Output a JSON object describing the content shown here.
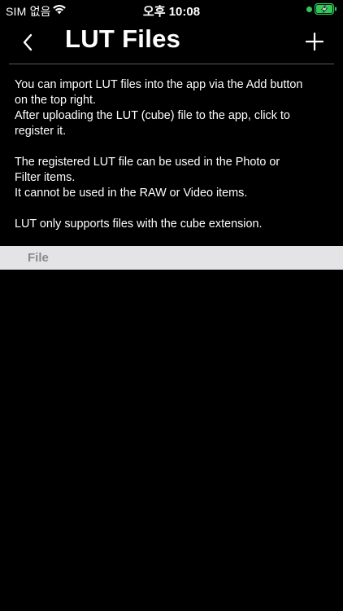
{
  "status_bar": {
    "carrier": "SIM 없음",
    "time": "오후 10:08",
    "icons": [
      "wifi-icon",
      "camera-in-use-dot",
      "battery-charging-icon"
    ],
    "colors": {
      "dot": "#31c75a",
      "battery": "#31c75a"
    }
  },
  "nav": {
    "back_icon": "chevron-left-icon",
    "title": "LUT Files",
    "add_icon": "plus-icon"
  },
  "description": {
    "paragraphs": [
      "You can import LUT files into the app via the Add button\non the top right.\nAfter uploading the LUT (cube) file to the app, click to\nregister it.",
      "The registered LUT file can be used in the Photo or\nFilter items.\nIt cannot be used in the RAW or Video items.",
      "LUT only supports files with the cube extension."
    ]
  },
  "table": {
    "header": "File",
    "rows": []
  }
}
